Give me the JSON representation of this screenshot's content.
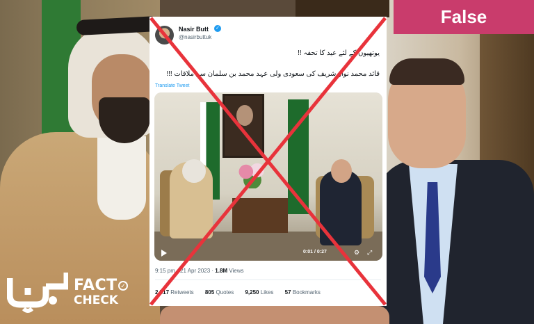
{
  "verdict": {
    "label": "False",
    "color": "#c93c6c"
  },
  "tweet": {
    "author_name": "Nasir Butt",
    "author_handle": "@nasirbuttuk",
    "verified_icon": "verified-badge-icon",
    "text_line1": "یوتھیوں کے لئے  عید کا تحفہ !!",
    "text_line2": "قائد محمد نواز شریف کی سعودی ولی عہد محمد بن سلمان سے ملاقات  !!!",
    "translate_label": "Translate Tweet",
    "video": {
      "elapsed": "0:01",
      "duration": "0:27",
      "play_icon": "play-icon",
      "settings_icon": "gear-icon",
      "fullscreen_icon": "fullscreen-icon"
    },
    "time": "9:15 pm",
    "date": "21 Apr 2023",
    "views_count": "1.8M",
    "views_label": "Views",
    "retweets_count": "2,517",
    "retweets_label": "Retweets",
    "quotes_count": "805",
    "quotes_label": "Quotes",
    "likes_count": "9,250",
    "likes_label": "Likes",
    "bookmarks_count": "57",
    "bookmarks_label": "Bookmarks"
  },
  "overlay": {
    "cross_color": "#e8333b",
    "cross_icon": "red-cross-mark"
  },
  "logo": {
    "word1": "FACT",
    "word2": "CHECK",
    "tick_icon": "check-circle-icon"
  }
}
